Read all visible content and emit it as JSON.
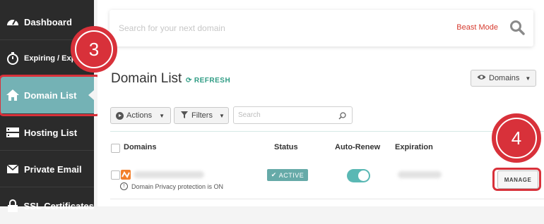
{
  "sidebar": {
    "items": [
      {
        "label": "Dashboard",
        "icon": "speedometer-icon"
      },
      {
        "label": "Expiring / Expired",
        "icon": "timer-icon"
      },
      {
        "label": "Domain List",
        "icon": "home-icon",
        "active": true
      },
      {
        "label": "Hosting List",
        "icon": "server-icon"
      },
      {
        "label": "Private Email",
        "icon": "envelope-icon"
      },
      {
        "label": "SSL Certificates",
        "icon": "lock-icon"
      }
    ]
  },
  "search": {
    "placeholder": "Search for your next domain",
    "beast_mode": "Beast Mode"
  },
  "header": {
    "title": "Domain List",
    "refresh": "REFRESH",
    "domains_dropdown": "Domains"
  },
  "toolbar": {
    "actions": "Actions",
    "filters": "Filters",
    "search_placeholder": "Search"
  },
  "table": {
    "columns": [
      "Domains",
      "Status",
      "Auto-Renew",
      "Expiration"
    ],
    "rows": [
      {
        "privacy_note": "Domain Privacy protection is ON",
        "status": "ACTIVE",
        "auto_renew": true,
        "manage": "MANAGE"
      }
    ]
  },
  "callouts": {
    "step3": "3",
    "step4": "4"
  },
  "colors": {
    "accent": "#2f9c84",
    "active_sidebar": "#74b2b5",
    "callout": "#d8313a",
    "beast_mode": "#d63b2f"
  }
}
